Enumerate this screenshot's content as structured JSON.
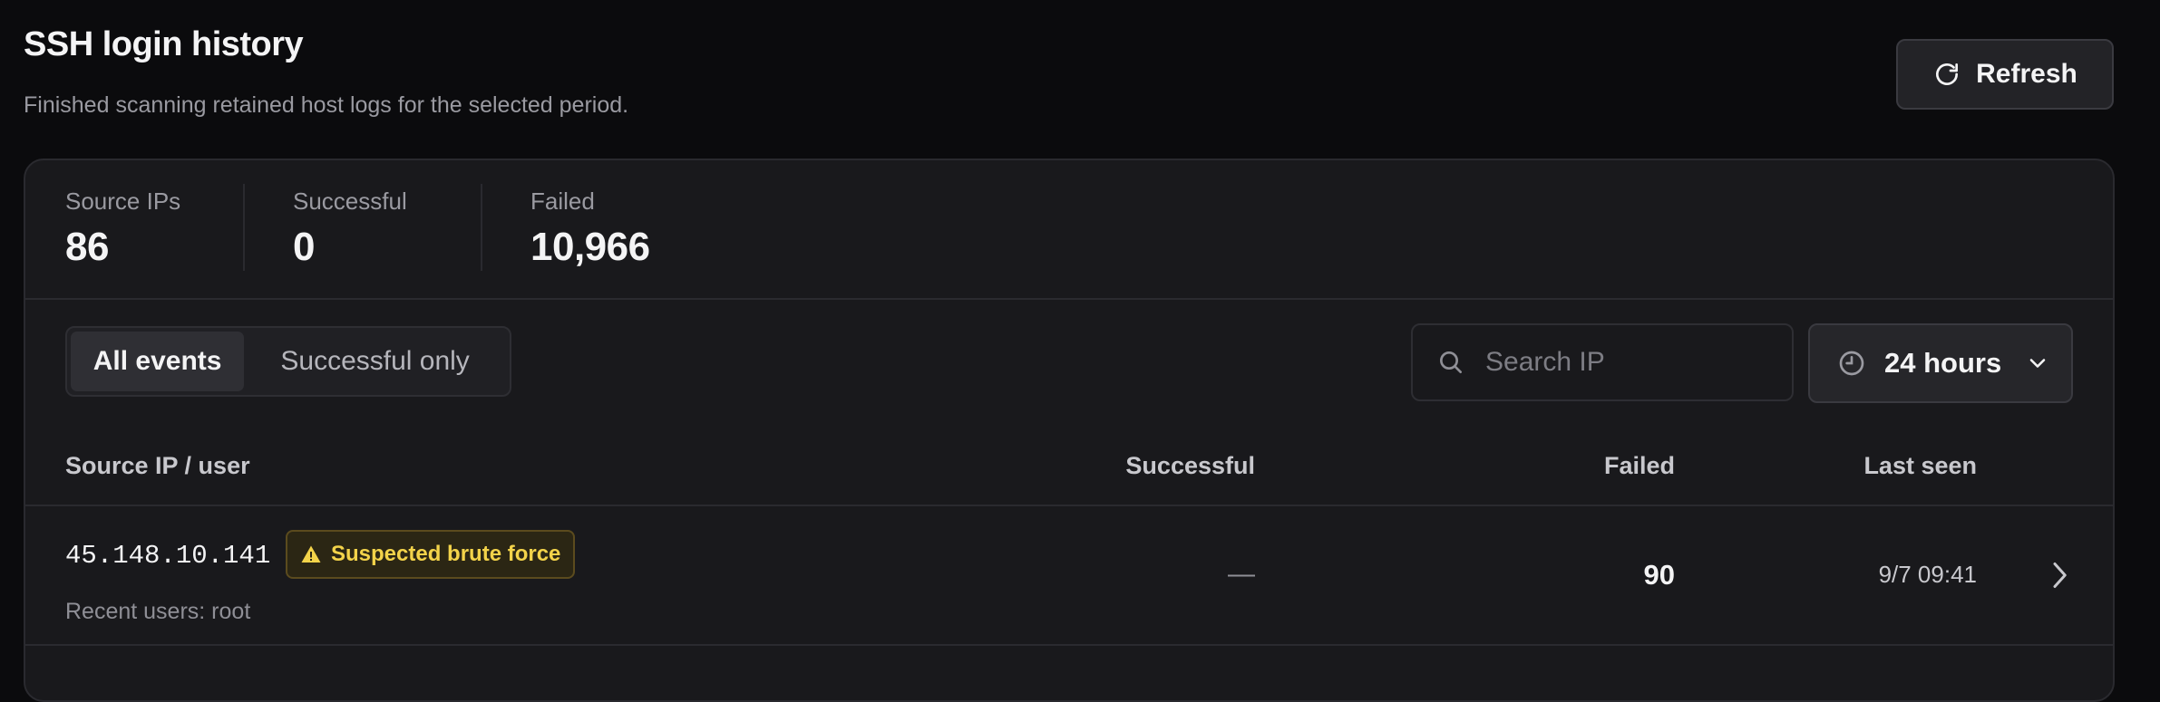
{
  "header": {
    "title": "SSH login history",
    "subtitle": "Finished scanning retained host logs for the selected period.",
    "refresh_label": "Refresh"
  },
  "stats": [
    {
      "label": "Source IPs",
      "value": "86"
    },
    {
      "label": "Successful",
      "value": "0"
    },
    {
      "label": "Failed",
      "value": "10,966"
    }
  ],
  "filters": {
    "options": [
      "All events",
      "Successful only"
    ],
    "selected": "All events"
  },
  "search": {
    "placeholder": "Search IP",
    "value": ""
  },
  "time_range": {
    "selected": "24 hours"
  },
  "table": {
    "columns": [
      "Source IP / user",
      "Successful",
      "Failed",
      "Last seen"
    ],
    "rows": [
      {
        "ip": "45.148.10.141",
        "badge": "Suspected brute force",
        "recent_users": "Recent users: root",
        "successful": "—",
        "failed": "90",
        "last_seen": "9/7 09:41"
      }
    ]
  },
  "icons": {
    "refresh": "refresh-icon",
    "search": "search-icon",
    "clock": "clock-icon",
    "dropdown": "chevron-down-icon",
    "warning": "warning-icon",
    "row_open": "chevron-right-icon"
  },
  "colors": {
    "background": "#0b0b0d",
    "card": "#19191c",
    "warning_text": "#f3d34a",
    "warning_bg": "#2b2614"
  }
}
